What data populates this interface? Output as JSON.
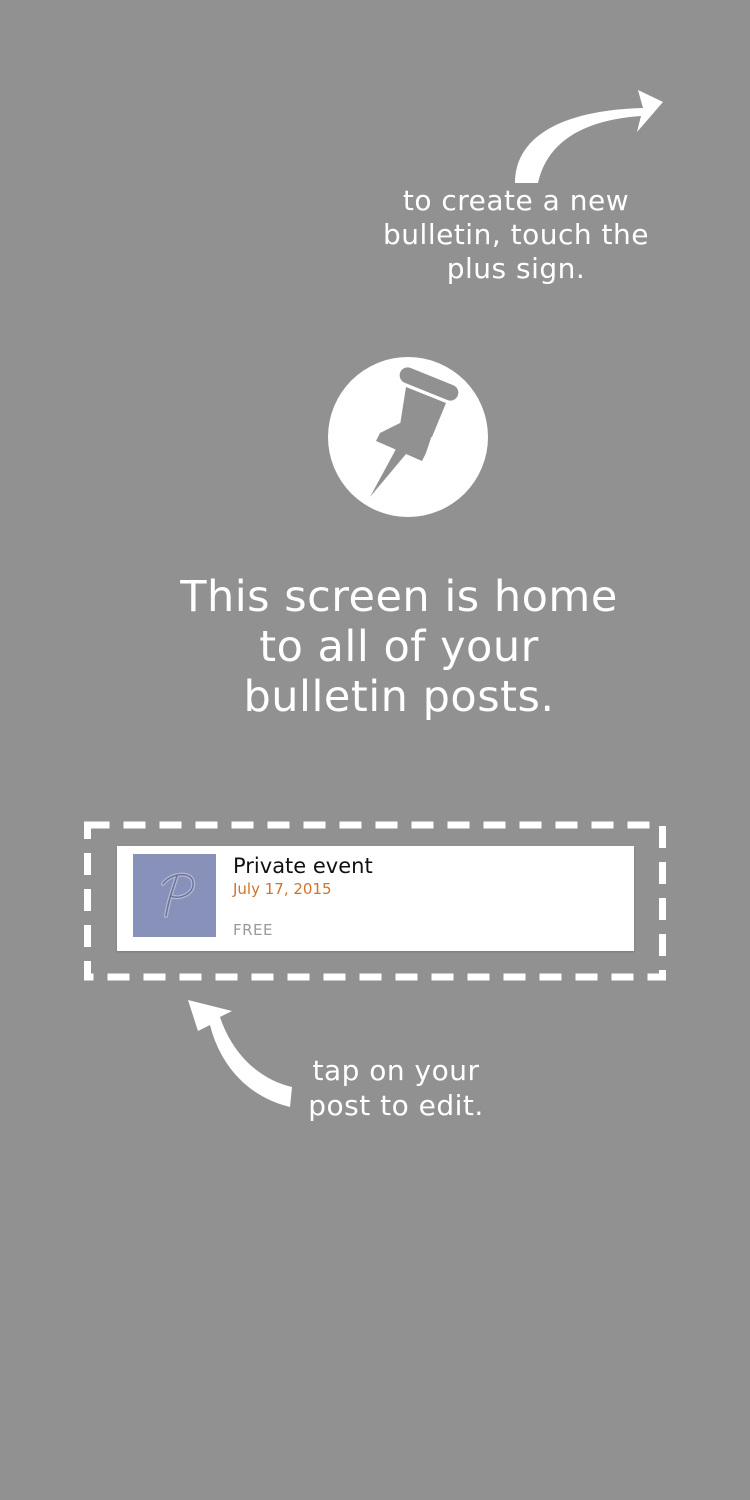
{
  "hints": {
    "create": {
      "lines": [
        "to create a new",
        "bulletin, touch the",
        "plus sign."
      ]
    },
    "edit": {
      "lines": [
        "tap on your",
        "post to edit."
      ]
    }
  },
  "headline": {
    "lines": [
      "This screen is home",
      "to all of your",
      "bulletin posts."
    ]
  },
  "icons": {
    "main": "pushpin-icon",
    "thumbnail": "script-p-logo-icon"
  },
  "sample_post": {
    "title": "Private event",
    "date": "July 17, 2015",
    "price": "FREE"
  },
  "colors": {
    "background": "#919191",
    "date_accent": "#d0742a",
    "thumbnail_bg": "#8891b9"
  }
}
